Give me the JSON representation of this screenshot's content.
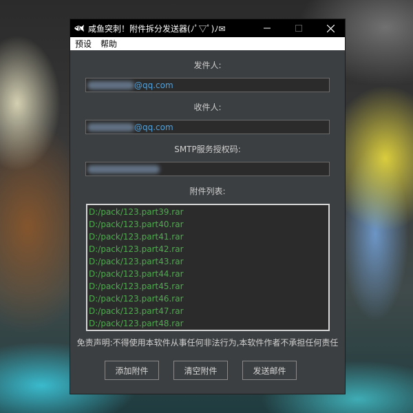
{
  "window": {
    "title": "咸鱼突刺！附件拆分发送器(ﾉﾟ▽ﾟ)ﾉ✉",
    "controls": {
      "minimize": "—",
      "maximize": "☐",
      "close": "✕"
    }
  },
  "menu": {
    "items": [
      "预设",
      "帮助"
    ]
  },
  "form": {
    "sender_label": "发件人:",
    "sender_value": "@qq.com",
    "receiver_label": "收件人:",
    "receiver_value": "@qq.com",
    "smtp_label": "SMTP服务授权码:",
    "smtp_value": ""
  },
  "attachments": {
    "label": "附件列表:",
    "items": [
      "D:/pack/123.part39.rar",
      "D:/pack/123.part40.rar",
      "D:/pack/123.part41.rar",
      "D:/pack/123.part42.rar",
      "D:/pack/123.part43.rar",
      "D:/pack/123.part44.rar",
      "D:/pack/123.part45.rar",
      "D:/pack/123.part46.rar",
      "D:/pack/123.part47.rar",
      "D:/pack/123.part48.rar"
    ]
  },
  "disclaimer": "免责声明:不得使用本软件从事任何非法行为,本软件作者不承担任何责任",
  "buttons": {
    "add": "添加附件",
    "clear": "清空附件",
    "send": "发送邮件"
  },
  "colors": {
    "list_text": "#4cae4c",
    "email_text": "#4fa3e0",
    "window_bg": "#3c3f41"
  },
  "icons": {
    "app": "fish-icon"
  }
}
